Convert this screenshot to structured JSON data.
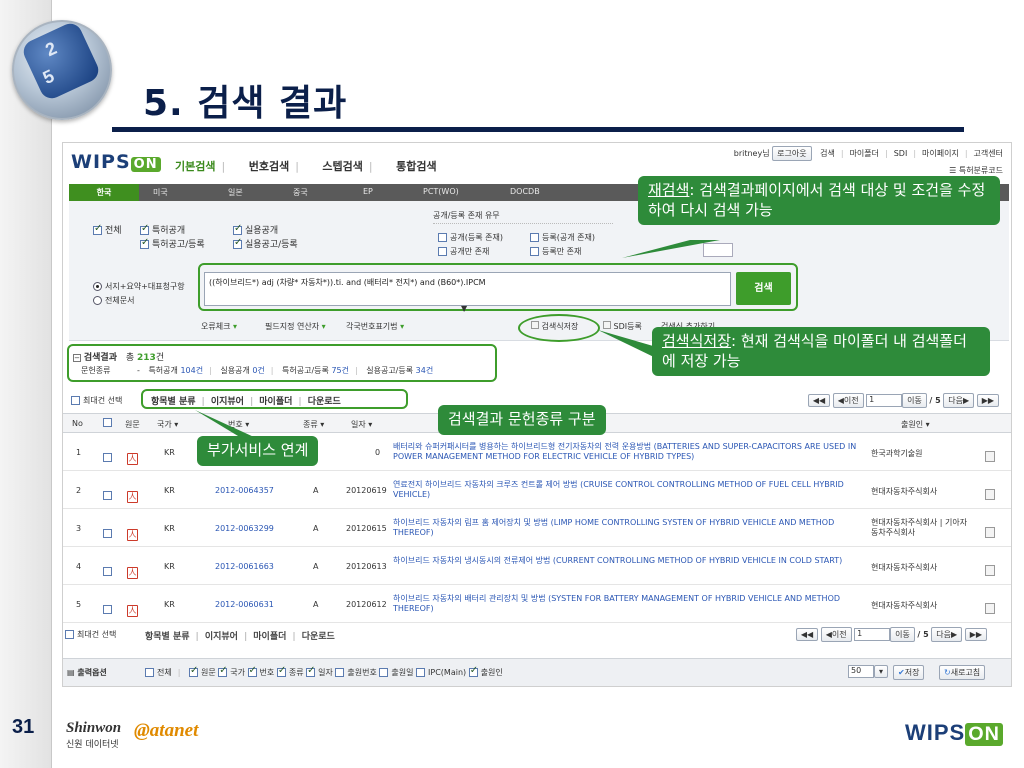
{
  "slide": {
    "title": "5. 검색 결과",
    "page_number": "31",
    "footer_left_brand": "Shinwon",
    "footer_left_sub": "신원 데이터넷",
    "footer_mid_brand": "@atanet",
    "footer_right_brand": "WIPS",
    "footer_right_badge": "ON",
    "logo_glyphs": [
      "2",
      "5"
    ]
  },
  "app": {
    "logo": "WIPS",
    "logo_badge": "ON",
    "top_nav": [
      "기본검색",
      "번호검색",
      "스텝검색",
      "통합검색"
    ],
    "user_links": [
      "britney님",
      "로그아웃",
      "검색",
      "마이폴더",
      "SDI",
      "마이페이지",
      "고객센터"
    ],
    "patent_code_link": "특허분류코드",
    "country_tabs": [
      "한국",
      "미국",
      "일본",
      "중국",
      "EP",
      "PCT(WO)",
      "DOCDB"
    ],
    "doc_types": {
      "all": "전체",
      "patent_pub": "특허공개",
      "patent_reg": "특허공고/등록",
      "utility_pub": "실용공개",
      "utility_reg": "실용공고/등록"
    },
    "status_title": "공개/등록 존재 유무",
    "status_options": [
      "공개(등록 존재)",
      "등록(공개 존재)",
      "공개만 존재",
      "등록만 존재"
    ],
    "scope_options": [
      "서지+요약+대표청구항",
      "전체문서"
    ],
    "query": "((하이브리드*) adj (차량* 자동차*)).ti. and (배터리* 전지*) and (B60*).IPCM",
    "search_button": "검색",
    "tools": [
      "오류체크",
      "필드지정 연산자",
      "각국번호표기법"
    ],
    "save_query": "검색식저장",
    "sdi_register": "SDI등록",
    "save_query_other": "검색식 추가하기",
    "summary": {
      "label": "검색결과",
      "total_prefix": "총",
      "total": "213",
      "total_suffix": "건",
      "doc_label": "문헌종류",
      "items": [
        {
          "label": "특허공개",
          "count": "104건"
        },
        {
          "label": "실용공개",
          "count": "0건"
        },
        {
          "label": "특허공고/등록",
          "count": "75건"
        },
        {
          "label": "실용공고/등록",
          "count": "34건"
        }
      ]
    },
    "service_bar": [
      "항목별 분류",
      "이지뷰어",
      "마이폴더",
      "다운로드"
    ],
    "select_max": "최대건 선택",
    "pager": {
      "prev": "이전",
      "page": "1",
      "go": "이동",
      "total": "/ 5",
      "next": "다음"
    },
    "columns": [
      "No",
      "원문",
      "국가",
      "번호",
      "종류",
      "일자",
      "출원인"
    ],
    "rows": [
      {
        "no": "1",
        "country": "KR",
        "number": "",
        "kind": "",
        "date": "0",
        "title": "배터리와 슈퍼커패시터를 병용하는 하이브리드형 전기자동차의 전력 운용방법 (BATTERIES AND SUPER-CAPACITORS ARE USED IN POWER MANAGEMENT METHOD FOR ELECTRIC VEHICLE OF HYBRID TYPES)",
        "applicant": "한국과학기술원"
      },
      {
        "no": "2",
        "country": "KR",
        "number": "2012-0064357",
        "kind": "A",
        "date": "20120619",
        "title": "연료전지 하이브리드 자동차의 크루즈 컨트롤 제어 방법 (CRUISE CONTROL CONTROLLING METHOD OF FUEL CELL HYBRID VEHICLE)",
        "applicant": "현대자동차주식회사"
      },
      {
        "no": "3",
        "country": "KR",
        "number": "2012-0063299",
        "kind": "A",
        "date": "20120615",
        "title": "하이브리드 자동차의 림프 홈 제어장치 및 방법 (LIMP HOME CONTROLLING SYSTEN OF HYBRID VEHICLE AND METHOD THEREOF)",
        "applicant": "현대자동차주식회사 | 기아자동차주식회사"
      },
      {
        "no": "4",
        "country": "KR",
        "number": "2012-0061663",
        "kind": "A",
        "date": "20120613",
        "title": "하이브리드 자동차의 냉시동시의 전류제어 방법 (CURRENT CONTROLLING METHOD OF HYBRID VEHICLE IN COLD START)",
        "applicant": "현대자동차주식회사"
      },
      {
        "no": "5",
        "country": "KR",
        "number": "2012-0060631",
        "kind": "A",
        "date": "20120612",
        "title": "하이브리드 자동차의 배터리 관리장치 및 방법 (SYSTEN FOR BATTERY MANAGEMENT OF HYBRID VEHICLE AND METHOD THEREOF)",
        "applicant": "현대자동차주식회사"
      }
    ],
    "output_options": {
      "label": "출력옵션",
      "items": [
        {
          "label": "전체",
          "checked": false
        },
        {
          "label": "원문",
          "checked": true
        },
        {
          "label": "국가",
          "checked": true
        },
        {
          "label": "번호",
          "checked": true
        },
        {
          "label": "종류",
          "checked": true
        },
        {
          "label": "일자",
          "checked": true
        },
        {
          "label": "출원번호",
          "checked": false
        },
        {
          "label": "출원일",
          "checked": false
        },
        {
          "label": "IPC(Main)",
          "checked": false
        },
        {
          "label": "출원인",
          "checked": true
        }
      ],
      "per_page": "50",
      "save": "저장",
      "refresh": "새로고침"
    }
  },
  "callouts": {
    "research_title": "재검색",
    "research_body": ": 검색결과페이지에서 검색 대상 및 조건을 수정하여 다시 검색 가능",
    "save_title": "검색식저장",
    "save_body": ": 현재 검색식을 마이폴더 내 검색폴더에 저장 가능",
    "doc_type_split": "검색결과 문헌종류 구분",
    "extra_service": "부가서비스 연계"
  },
  "colors": {
    "navy": "#0b1f4a",
    "callout_green": "#2e8b3a",
    "highlight_green": "#3e9d2b",
    "tab_bar": "#5a5a5a"
  }
}
